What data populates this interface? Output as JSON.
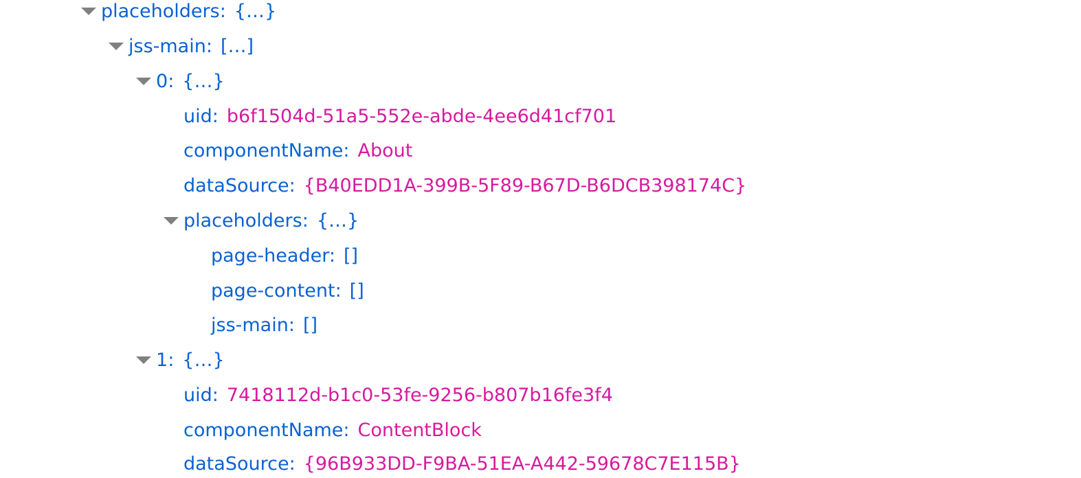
{
  "tree": {
    "rows": [
      {
        "key": "placeholders",
        "preview": "{…}",
        "expandable": true
      },
      {
        "key": "jss-main",
        "preview": "[…]",
        "expandable": true
      },
      {
        "key": "0",
        "preview": "{…}",
        "expandable": true
      },
      {
        "key": "uid",
        "value": "b6f1504d-51a5-552e-abde-4ee6d41cf701"
      },
      {
        "key": "componentName",
        "value": "About"
      },
      {
        "key": "dataSource",
        "value": "{B40EDD1A-399B-5F89-B67D-B6DCB398174C}"
      },
      {
        "key": "placeholders",
        "preview": "{…}",
        "expandable": true
      },
      {
        "key": "page-header",
        "preview": "[]"
      },
      {
        "key": "page-content",
        "preview": "[]"
      },
      {
        "key": "jss-main",
        "preview": "[]"
      },
      {
        "key": "1",
        "preview": "{…}",
        "expandable": true
      },
      {
        "key": "uid",
        "value": "7418112d-b1c0-53fe-9256-b807b16fe3f4"
      },
      {
        "key": "componentName",
        "value": "ContentBlock"
      },
      {
        "key": "dataSource",
        "value": "{96B933DD-F9BA-51EA-A442-59678C7E115B}"
      }
    ]
  },
  "colors": {
    "key": "#0b62d1",
    "value": "#d61a9f",
    "toggle": "#808080"
  },
  "icons": {
    "expand_toggle": "triangle-down-icon"
  }
}
